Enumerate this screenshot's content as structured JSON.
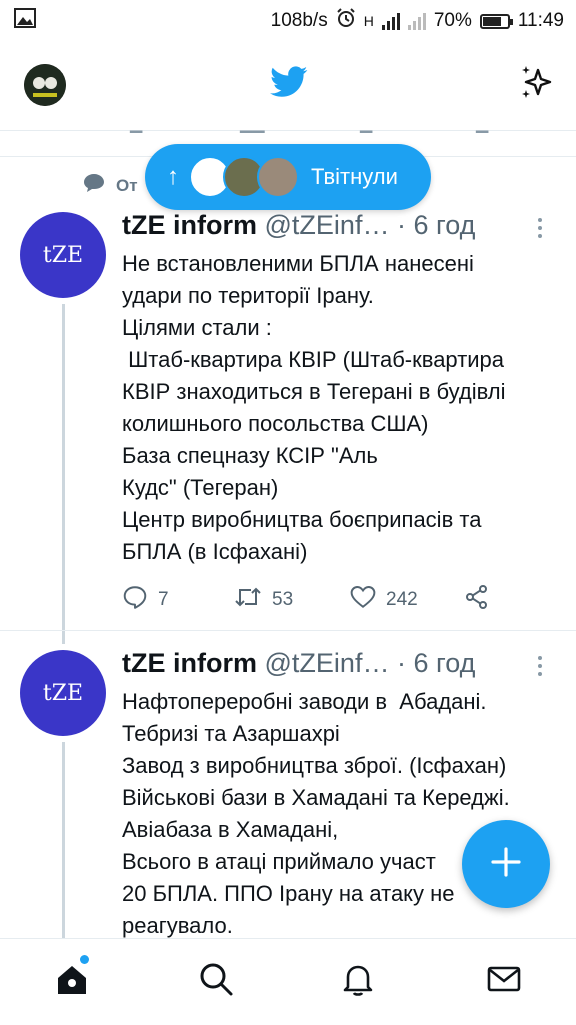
{
  "status_bar": {
    "net_speed": "108b/s",
    "network_label": "H",
    "battery": "70%",
    "time": "11:49"
  },
  "colors": {
    "accent": "#1da1f2",
    "avatar_bg": "#3a36c8",
    "text": "#0f1419",
    "muted": "#536471"
  },
  "header": {
    "logo_icon": "twitter-bird-icon",
    "action_icon": "sparkle-icon"
  },
  "new_tweets_pill": {
    "arrow": "↑",
    "label": "Твітнули"
  },
  "social_context": {
    "icon": "comment-bubble-icon",
    "text": "От"
  },
  "tweets": [
    {
      "avatar_text": "tZE",
      "name": "tZE inform",
      "handle": "@tZEinf…",
      "sep": "·",
      "time": "6 год",
      "lines": [
        "Не встановленими БПЛА нанесені",
        "удари по території Ірану.",
        "Цілями стали :",
        " Штаб-квартира КВІР (Штаб-квартира",
        "КВІР знаходиться в Тегерані в будівлі",
        "колишнього посольства США)",
        "База спецназу КСІР \"Аль",
        "Кудс\" (Тегеран)",
        "Центр виробництва боєприпасів та",
        "БПЛА (в Ісфахані)"
      ],
      "replies": "7",
      "retweets": "53",
      "likes": "242"
    },
    {
      "avatar_text": "tZE",
      "name": "tZE inform",
      "handle": "@tZEinf…",
      "sep": "·",
      "time": "6 год",
      "lines": [
        "Нафтопереробні заводи в  Абадані.",
        "Тебризі та Азаршахрі",
        "Завод з виробництва зброї. (Ісфахан)",
        "Військові бази в Хамадані та Кереджі.",
        "Авіабаза в Хамадані,",
        "Всього в атаці приймало участ",
        "20 БПЛА. ППО Ірану на атаку не",
        "реагувало."
      ]
    }
  ],
  "bottom_nav": [
    "home-icon",
    "search-icon",
    "notifications-bell-icon",
    "messages-mail-icon"
  ]
}
